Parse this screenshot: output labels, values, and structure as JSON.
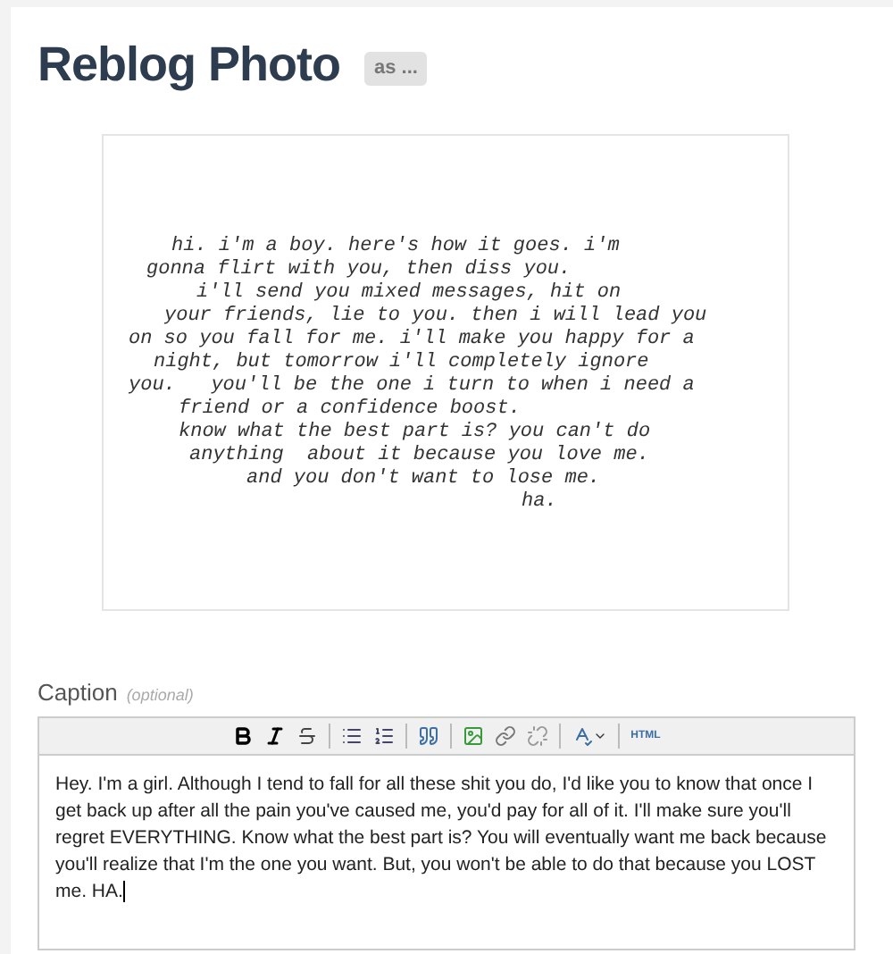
{
  "header": {
    "title": "Reblog Photo",
    "as_badge": "as ..."
  },
  "photo": {
    "lines": [
      "hi. i'm a boy. here's how it goes. i'm",
      "gonna flirt with you, then diss you.",
      "i'll send you mixed messages, hit on",
      "your friends, lie to you. then i will lead you",
      "on so you fall for me. i'll make you happy for a",
      "night, but tomorrow i'll completely ignore",
      "you.   you'll be the one i turn to when i need a",
      "friend or a confidence boost.",
      "know what the best part is? you can't do",
      "anything  about it because you love me.",
      "and you don't want to lose me.",
      "ha."
    ]
  },
  "caption": {
    "label": "Caption",
    "hint": "(optional)",
    "toolbar": [
      {
        "kind": "bold"
      },
      {
        "kind": "italic"
      },
      {
        "kind": "strike"
      },
      {
        "kind": "separator"
      },
      {
        "kind": "bullets"
      },
      {
        "kind": "numbers"
      },
      {
        "kind": "separator"
      },
      {
        "kind": "quote"
      },
      {
        "kind": "separator"
      },
      {
        "kind": "image"
      },
      {
        "kind": "link"
      },
      {
        "kind": "unlink"
      },
      {
        "kind": "separator"
      },
      {
        "kind": "spellcheck"
      },
      {
        "kind": "separator"
      },
      {
        "kind": "html",
        "label": "HTML"
      }
    ],
    "value": "Hey. I'm a girl. Although I tend to fall for all these shit you do, I'd like you to know that once I get back up after all the pain you've caused me, you'd pay for all of it. I'll make sure you'll regret EVERYTHING. Know what the best part is? You will eventually want me back because you'll realize that I'm the one you want.  But, you won't be able to do that because you LOST me. HA."
  }
}
